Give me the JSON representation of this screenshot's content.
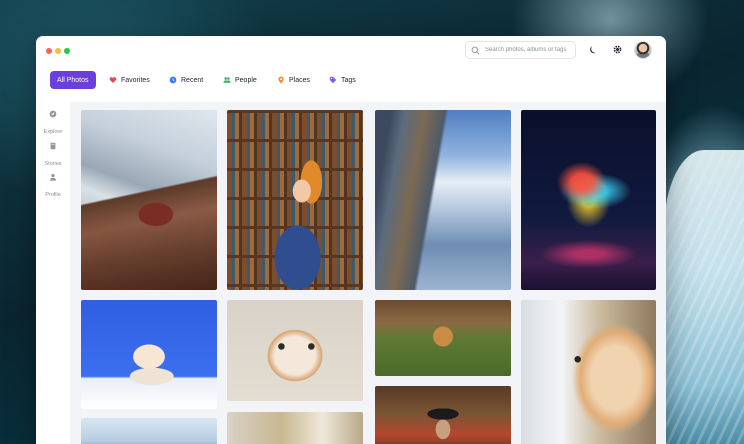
{
  "window": {
    "controls": [
      "close",
      "minimize",
      "maximize"
    ]
  },
  "search": {
    "placeholder": "Search photos, albums or tags",
    "value": ""
  },
  "header_icons": [
    "moon-icon",
    "gear-icon"
  ],
  "tabs": [
    {
      "label": "All Photos",
      "active": true,
      "icon": null
    },
    {
      "label": "Favorites",
      "active": false,
      "icon": "heart-icon",
      "color": "#e04b5a"
    },
    {
      "label": "Recent",
      "active": false,
      "icon": "clock-icon",
      "color": "#3b7ce8"
    },
    {
      "label": "People",
      "active": false,
      "icon": "people-icon",
      "color": "#2fb36a"
    },
    {
      "label": "Places",
      "active": false,
      "icon": "pin-icon",
      "color": "#f08a24"
    },
    {
      "label": "Tags",
      "active": false,
      "icon": "tag-icon",
      "color": "#8a5ae0"
    }
  ],
  "sidebar": {
    "items": [
      {
        "label": "Explore",
        "icon": "compass-icon"
      },
      {
        "label": "Stories",
        "icon": "book-icon"
      },
      {
        "label": "Profile",
        "icon": "user-icon"
      }
    ]
  },
  "photos": [
    {
      "subject": "mountain-fortress"
    },
    {
      "subject": "girl-in-library"
    },
    {
      "subject": "cliff-mountains"
    },
    {
      "subject": "light-dancer"
    },
    {
      "subject": "cat-blue-background"
    },
    {
      "subject": "cat-closeup"
    },
    {
      "subject": "puppy-running"
    },
    {
      "subject": "man-in-hat-market"
    },
    {
      "subject": "cat-at-window"
    },
    {
      "subject": "hallway"
    },
    {
      "subject": "snowy-peak"
    }
  ],
  "colors": {
    "accent": "#6a3fdc",
    "content_bg": "#f3f4f8"
  }
}
